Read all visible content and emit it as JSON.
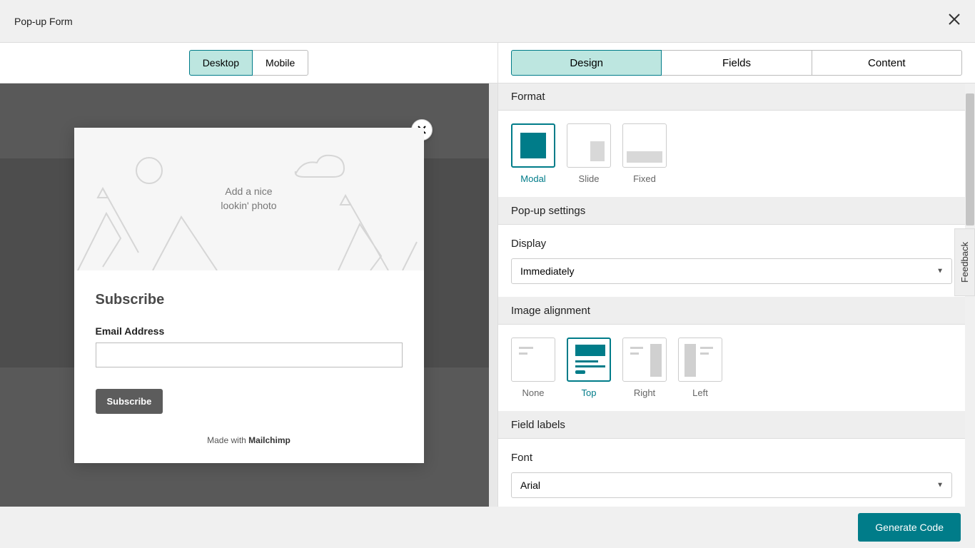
{
  "header": {
    "title": "Pop-up Form"
  },
  "deviceToggle": {
    "desktop": "Desktop",
    "mobile": "Mobile"
  },
  "popup": {
    "imageText1": "Add a nice",
    "imageText2": "lookin' photo",
    "heading": "Subscribe",
    "emailLabel": "Email Address",
    "submit": "Subscribe",
    "footerPrefix": "Made with ",
    "footerBrand": "Mailchimp"
  },
  "tabs": {
    "design": "Design",
    "fields": "Fields",
    "content": "Content"
  },
  "sections": {
    "format": "Format",
    "popupSettings": "Pop-up settings",
    "display": "Display",
    "imageAlignment": "Image alignment",
    "fieldLabels": "Field labels",
    "font": "Font"
  },
  "formatOptions": {
    "modal": "Modal",
    "slide": "Slide",
    "fixed": "Fixed"
  },
  "displaySelect": "Immediately",
  "alignOptions": {
    "none": "None",
    "top": "Top",
    "right": "Right",
    "left": "Left"
  },
  "fontSelect": "Arial",
  "generate": "Generate Code",
  "feedback": "Feedback"
}
